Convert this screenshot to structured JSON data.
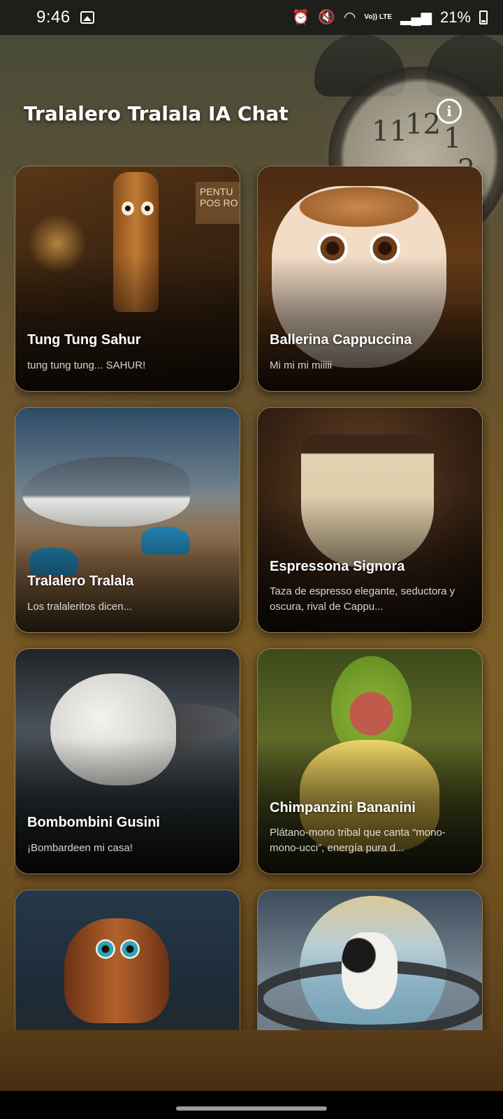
{
  "status_bar": {
    "time": "9:46",
    "battery": "21%",
    "lte_label": "Vo)) LTE",
    "icons": [
      "image-icon",
      "alarm-icon",
      "mute-icon",
      "wifi-icon",
      "signal-icon",
      "battery-icon"
    ]
  },
  "header": {
    "title": "Tralalero Tralala IA Chat",
    "info_icon": "info-icon"
  },
  "characters": [
    {
      "name": "Tung Tung Sahur",
      "description": "tung tung tung... SAHUR!"
    },
    {
      "name": "Ballerina Cappuccina",
      "description": "Mi mi mi miiiii"
    },
    {
      "name": "Tralalero Tralala",
      "description": "Los tralaleritos dicen..."
    },
    {
      "name": "Espressona Signora",
      "description": "Taza de espresso elegante, seductora y oscura, rival de Cappu..."
    },
    {
      "name": "Bombombini Gusini",
      "description": "¡Bombardeen mi casa!"
    },
    {
      "name": "Chimpanzini Bananini",
      "description": "Plátano-mono tribal que canta “mono-mono-ucci”, energía pura d..."
    }
  ],
  "background_art": {
    "sign_text": "PENTU POS RO",
    "clock_numbers": [
      "11",
      "12",
      "1",
      "2",
      "3"
    ]
  },
  "colors": {
    "status_bar_bg": "#1d1f1b",
    "title_text": "#ffffff",
    "nav_bar": "#000000"
  }
}
